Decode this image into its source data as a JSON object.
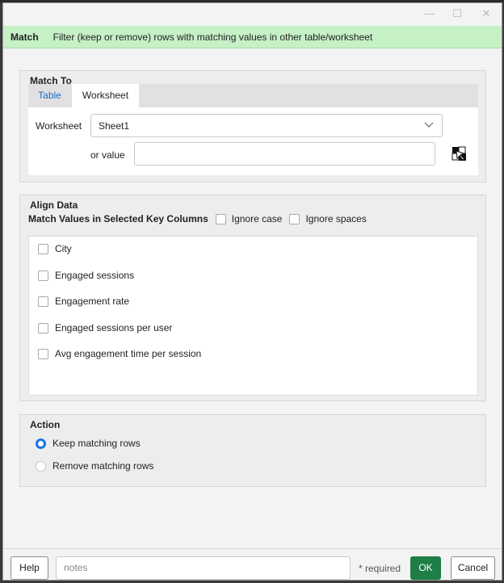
{
  "window": {
    "minimize": "—",
    "maximize": "☐",
    "close": "✕"
  },
  "header": {
    "title": "Match",
    "description": "Filter (keep or remove) rows with matching values in other table/worksheet",
    "color": "#c6f0c6"
  },
  "match_to": {
    "title": "Match To",
    "tabs": [
      {
        "label": "Table"
      },
      {
        "label": "Worksheet"
      }
    ],
    "active_tab": "Worksheet",
    "worksheet_label": "Worksheet",
    "worksheet_value": "Sheet1",
    "or_value_label": "or value",
    "or_value_value": "",
    "picker_icon": "cell-picker-icon"
  },
  "align_data": {
    "title": "Align Data",
    "key_columns_label": "Match Values in Selected Key Columns",
    "ignore_case_label": "Ignore case",
    "ignore_spaces_label": "Ignore spaces",
    "columns": [
      {
        "label": "City",
        "checked": false
      },
      {
        "label": "Engaged sessions",
        "checked": false
      },
      {
        "label": "Engagement rate",
        "checked": false
      },
      {
        "label": "Engaged sessions per user",
        "checked": false
      },
      {
        "label": "Avg engagement time per session",
        "checked": false
      }
    ]
  },
  "action": {
    "title": "Action",
    "options": [
      {
        "label": "Keep matching rows",
        "selected": true
      },
      {
        "label": "Remove matching rows",
        "selected": false
      }
    ]
  },
  "footer": {
    "help_label": "Help",
    "notes_placeholder": "notes",
    "required_text": "* required",
    "ok_label": "OK",
    "cancel_label": "Cancel",
    "ok_color": "#1e7e46"
  }
}
